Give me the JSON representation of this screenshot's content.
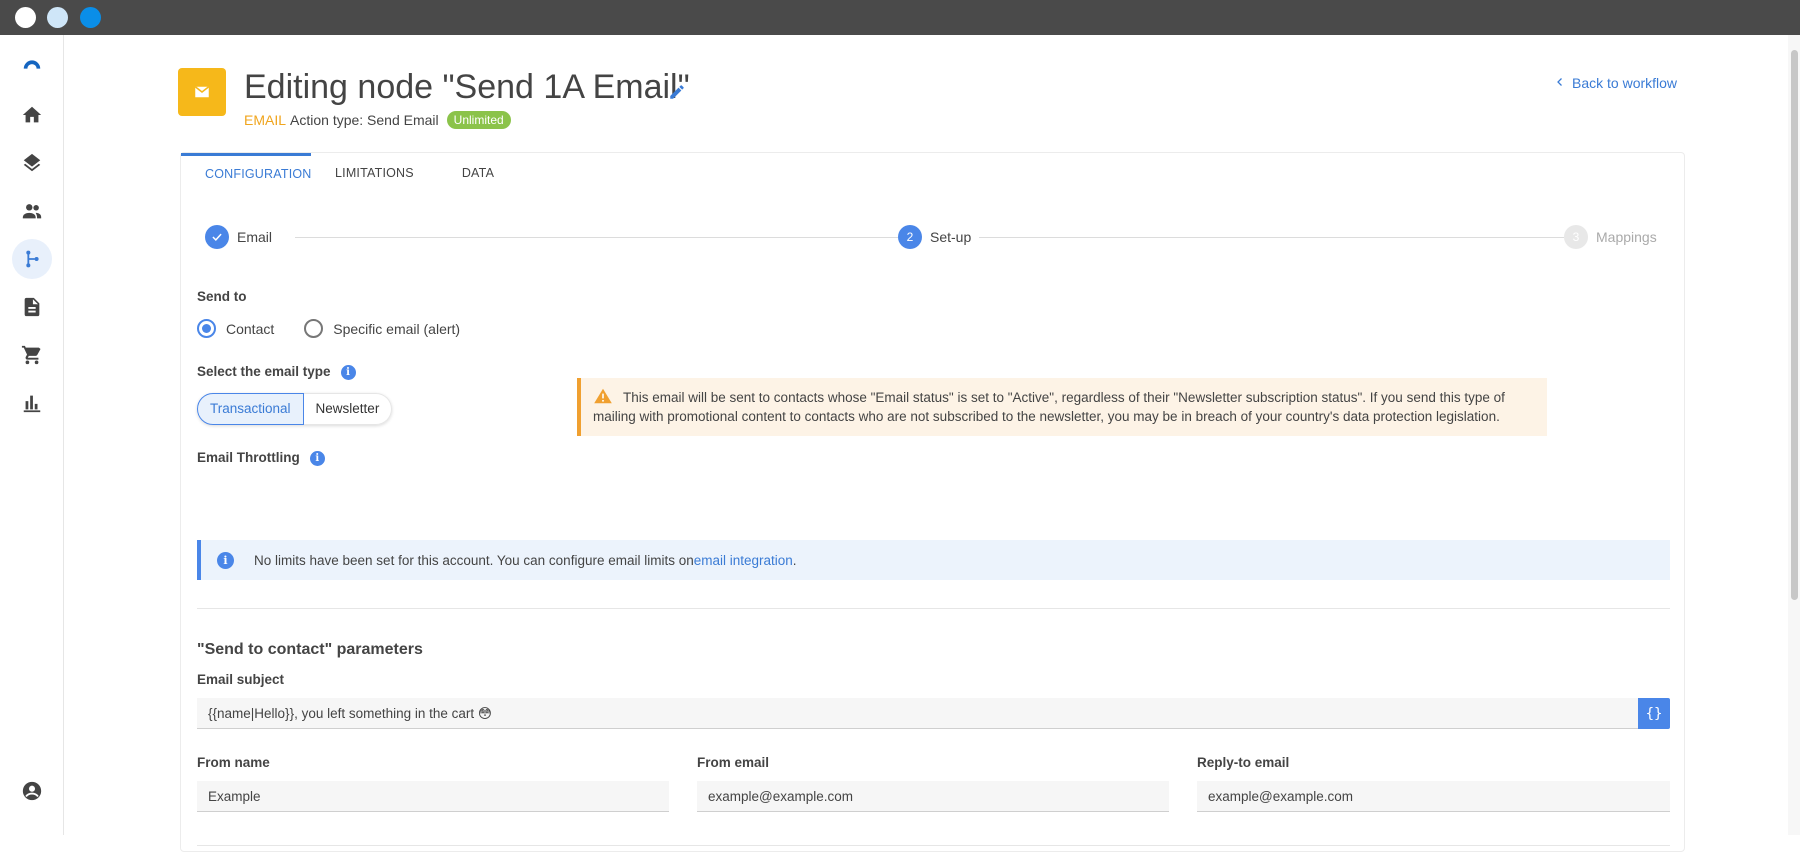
{
  "window": {
    "controls": [
      "close",
      "minimize",
      "maximize"
    ]
  },
  "sidebar": {
    "items": [
      {
        "name": "logo-icon",
        "active": false
      },
      {
        "name": "home-icon",
        "active": false
      },
      {
        "name": "layers-icon",
        "active": false
      },
      {
        "name": "contacts-icon",
        "active": false
      },
      {
        "name": "workflow-icon",
        "active": true
      },
      {
        "name": "document-icon",
        "active": false
      },
      {
        "name": "cart-icon",
        "active": false
      },
      {
        "name": "chart-icon",
        "active": false
      },
      {
        "name": "account-icon",
        "active": false
      }
    ]
  },
  "header": {
    "title": "Editing node \"Send 1A Email\"",
    "node_type": "EMAIL",
    "action_type": "Action type: Send Email",
    "badge": "Unlimited",
    "back_link": "Back to workflow",
    "node_icon": "envelope-icon",
    "accent_color": "#f6b81a"
  },
  "tabs": [
    {
      "label": "CONFIGURATION",
      "active": true
    },
    {
      "label": "LIMITATIONS",
      "active": false
    },
    {
      "label": "DATA",
      "active": false
    }
  ],
  "stepper": {
    "steps": [
      {
        "number": "1",
        "label": "Email",
        "state": "done"
      },
      {
        "number": "2",
        "label": "Set-up",
        "state": "current"
      },
      {
        "number": "3",
        "label": "Mappings",
        "state": "pending"
      }
    ]
  },
  "send_to": {
    "label": "Send to",
    "options": [
      {
        "label": "Contact",
        "checked": true
      },
      {
        "label": "Specific email (alert)",
        "checked": false
      }
    ]
  },
  "email_type": {
    "label": "Select the email type",
    "options": [
      {
        "label": "Transactional",
        "selected": true
      },
      {
        "label": "Newsletter",
        "selected": false
      }
    ]
  },
  "warning": {
    "text": "This email will be sent to contacts whose \"Email status\" is set to \"Active\", regardless of their \"Newsletter subscription status\". If you send this type of mailing with promotional content to contacts who are not subscribed to the newsletter, you may be in breach of your country's data protection legislation."
  },
  "throttling": {
    "label": "Email Throttling",
    "info_text": "No limits have been set for this account. You can configure email limits on ",
    "link_text": "email integration",
    "info_suffix": "."
  },
  "parameters": {
    "title": "\"Send to contact\" parameters",
    "subject_label": "Email subject",
    "subject_value": "{{name|Hello}}, you left something in the cart 😳",
    "variables_button": "{}",
    "from_name_label": "From name",
    "from_name_value": "Example",
    "from_email_label": "From email",
    "from_email_value": "example@example.com",
    "reply_to_label": "Reply-to email",
    "reply_to_value": "example@example.com"
  }
}
